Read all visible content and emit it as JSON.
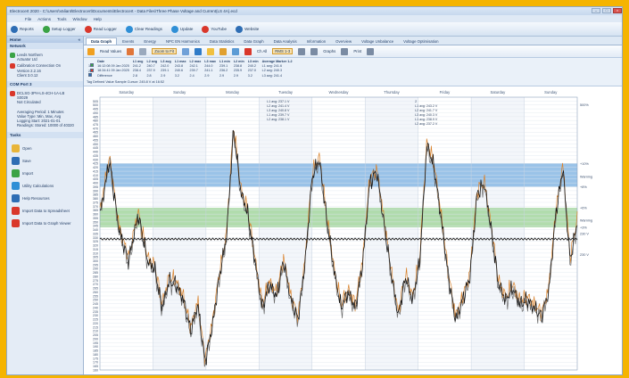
{
  "window": {
    "title": "Electrocert 2020 - C:\\Users\\Valiant\\Electrocert\\Documents\\Electrocert - Data Files\\Three Phase Voltage and Current(LS 4A).ecd"
  },
  "menu": [
    "File",
    "Actions",
    "Tools",
    "Window",
    "Help"
  ],
  "toolbar": [
    {
      "label": "Reports",
      "icon": "reports-icon",
      "color": "#2e6db4"
    },
    {
      "label": "Setup Logger",
      "icon": "setup-logger-icon",
      "color": "#3aa345"
    },
    {
      "label": "Read Logger",
      "icon": "read-logger-icon",
      "color": "#d9372b"
    },
    {
      "label": "Clear Readings",
      "icon": "clear-readings-icon",
      "color": "#2f8fd6"
    },
    {
      "label": "Update",
      "icon": "update-icon",
      "color": "#2f8fd6"
    },
    {
      "label": "YouTube",
      "icon": "youtube-icon",
      "color": "#d9372b"
    },
    {
      "label": "Website",
      "icon": "website-icon",
      "color": "#2e6db4"
    }
  ],
  "left_panel": {
    "header": "Home",
    "section1": "Network",
    "items": [
      {
        "lines": [
          "Leeds Northern",
          "Actuator Ltd"
        ],
        "icon": "site-icon",
        "color": "#3aa345"
      },
      {
        "lines": [
          "Calibration Connection On",
          "Version 2.2.16",
          "Client 3.0.12"
        ],
        "icon": "connection-icon",
        "color": "#d9372b"
      }
    ],
    "section2": "COM Port 3",
    "device": {
      "lines": [
        "DCLSG-3PH-LS-4CH-1A-LB",
        "S0029",
        "Not Circulated",
        "",
        "Averaging Period: 1 Minutes",
        "Value Type: Min, Max, Avg",
        "Logging Start: 2021-01-01",
        "Readings: Stored: 10000 of 40320"
      ]
    },
    "section3": "Tasks",
    "actions": [
      {
        "label": "Open",
        "icon": "folder-open-icon",
        "color": "#e8b53a"
      },
      {
        "label": "Save",
        "icon": "save-icon",
        "color": "#2e6db4"
      },
      {
        "label": "Import",
        "icon": "import-icon",
        "color": "#3aa345"
      },
      {
        "label": "Utility Calculations",
        "icon": "calculator-icon",
        "color": "#2f8fd6"
      },
      {
        "label": "Help Resources",
        "icon": "help-icon",
        "color": "#2e6db4"
      },
      {
        "label": "Import Data to Spreadsheet",
        "icon": "spreadsheet-icon",
        "color": "#d9372b"
      },
      {
        "label": "Import Data to Graph Viewer",
        "icon": "graph-export-icon",
        "color": "#d9372b"
      }
    ]
  },
  "tabs": [
    "Data Graph",
    "Events",
    "Energy",
    "NPC EN Harmonics",
    "Data Statistics",
    "Data Graph",
    "Data Analysis",
    "Information",
    "Overview",
    "Voltage Unbalance",
    "Voltage Optimisation"
  ],
  "chart_toolbar": {
    "mode": "Read Values",
    "zoom": "Zoom to Fit",
    "channel": "Ch All",
    "phases": "RMS 1-3",
    "graphs": "Graphs",
    "print": "Print"
  },
  "data_panel": {
    "headers": [
      "",
      "Date",
      "L1 avg",
      "L2 avg",
      "L3 avg",
      "L1 max",
      "L2 max",
      "L3 max",
      "L1 min",
      "L2 min",
      "L3 min",
      "Average Marker 1-2"
    ],
    "rows": [
      {
        "marker": "1",
        "color": "#3aa345",
        "cells": [
          "16:12:08 09 Jan 2025",
          "241.2",
          "240.7",
          "242.0",
          "243.8",
          "242.1",
          "244.0",
          "239.1",
          "238.8",
          "240.2",
          "L1 avg: 241.6"
        ]
      },
      {
        "marker": "2",
        "color": "#d9372b",
        "cells": [
          "18:34:41 09 Jan 2025",
          "238.4",
          "237.9",
          "239.1",
          "240.6",
          "239.7",
          "241.1",
          "236.2",
          "235.9",
          "237.0",
          "L2 avg: 240.3"
        ]
      },
      {
        "marker": "",
        "color": "#2e6db4",
        "cells": [
          "Difference",
          "2.8",
          "2.8",
          "2.9",
          "3.2",
          "2.4",
          "2.9",
          "2.9",
          "2.9",
          "3.2",
          "L3 avg: 241.4"
        ]
      }
    ],
    "note": "Tag Defined    Value Sample    Cursor: 245.8 V at 16:52"
  },
  "chart_data": {
    "type": "line",
    "days": [
      "Saturday",
      "Sunday",
      "Monday",
      "Tuesday",
      "Wednesday",
      "Thursday",
      "Friday",
      "Saturday",
      "Sunday"
    ],
    "y_ticks": [
      505,
      500,
      495,
      490,
      485,
      480,
      475,
      470,
      465,
      460,
      455,
      450,
      445,
      440,
      435,
      430,
      425,
      420,
      415,
      410,
      405,
      400,
      395,
      390,
      385,
      380,
      375,
      370,
      365,
      360,
      355,
      350,
      345,
      340,
      335,
      330,
      325,
      320,
      315,
      310,
      305,
      300,
      295,
      290,
      285,
      280,
      275,
      270,
      265,
      260,
      255,
      250,
      245,
      240,
      235,
      230,
      225,
      220,
      215,
      210,
      205,
      200,
      195,
      190,
      185,
      180,
      175,
      170,
      165,
      160
    ],
    "ylim": [
      160,
      510
    ],
    "bands": [
      {
        "from": 395,
        "to": 425,
        "color": "#8fbde6",
        "label": "+10%"
      },
      {
        "from": 343,
        "to": 368,
        "color": "#a8d8a4",
        "label": "+6%"
      }
    ],
    "right_labels": [
      {
        "value": 500,
        "text": "500%"
      },
      {
        "value": 425,
        "text": "+10%"
      },
      {
        "value": 408,
        "text": "Warning"
      },
      {
        "value": 395,
        "text": "+8%"
      },
      {
        "value": 368,
        "text": "+6%"
      },
      {
        "value": 352,
        "text": "Warning"
      },
      {
        "value": 343,
        "text": "+3%"
      },
      {
        "value": 335,
        "text": "230 V"
      },
      {
        "value": 308,
        "text": "230 V"
      }
    ],
    "annotations": [
      {
        "x": 0.35,
        "lines": [
          "L1 avg: 237.1 V",
          "L2 avg: 241.4 V",
          "L3 avg: 240.8 V",
          "L1 avg: 239.7 V",
          "L2 avg: 238.1 V"
        ]
      },
      {
        "x": 0.66,
        "lines": [
          "2",
          "L1 avg: 243.2 V",
          "L2 avg: 241.7 V",
          "L3 avg: 240.3 V",
          "L1 avg: 238.9 V",
          "L2 avg: 237.2 V"
        ]
      }
    ],
    "series": [
      {
        "name": "L1",
        "color": "#d9822b",
        "offset": 4
      },
      {
        "name": "L2",
        "color": "#6b6b6b",
        "offset": -4
      },
      {
        "name": "L3",
        "color": "#111111",
        "offset": 0
      },
      {
        "name": "Neutral",
        "color": "#222222",
        "flat": 328
      }
    ],
    "profile": [
      [
        0,
        360
      ],
      [
        0.02,
        430
      ],
      [
        0.04,
        340
      ],
      [
        0.06,
        300
      ],
      [
        0.08,
        360
      ],
      [
        0.1,
        300
      ],
      [
        0.115,
        290
      ],
      [
        0.13,
        240
      ],
      [
        0.145,
        275
      ],
      [
        0.16,
        270
      ],
      [
        0.175,
        250
      ],
      [
        0.19,
        210
      ],
      [
        0.205,
        245
      ],
      [
        0.22,
        170
      ],
      [
        0.235,
        215
      ],
      [
        0.25,
        280
      ],
      [
        0.265,
        330
      ],
      [
        0.28,
        470
      ],
      [
        0.295,
        390
      ],
      [
        0.31,
        360
      ],
      [
        0.325,
        300
      ],
      [
        0.34,
        240
      ],
      [
        0.355,
        270
      ],
      [
        0.37,
        255
      ],
      [
        0.385,
        300
      ],
      [
        0.4,
        250
      ],
      [
        0.415,
        225
      ],
      [
        0.43,
        300
      ],
      [
        0.445,
        410
      ],
      [
        0.46,
        430
      ],
      [
        0.475,
        355
      ],
      [
        0.49,
        290
      ],
      [
        0.505,
        240
      ],
      [
        0.52,
        260
      ],
      [
        0.535,
        240
      ],
      [
        0.55,
        295
      ],
      [
        0.565,
        400
      ],
      [
        0.58,
        415
      ],
      [
        0.595,
        350
      ],
      [
        0.61,
        285
      ],
      [
        0.625,
        230
      ],
      [
        0.64,
        280
      ],
      [
        0.655,
        250
      ],
      [
        0.67,
        300
      ],
      [
        0.685,
        450
      ],
      [
        0.7,
        420
      ],
      [
        0.715,
        355
      ],
      [
        0.73,
        280
      ],
      [
        0.745,
        225
      ],
      [
        0.76,
        250
      ],
      [
        0.775,
        280
      ],
      [
        0.79,
        385
      ],
      [
        0.805,
        400
      ],
      [
        0.82,
        340
      ],
      [
        0.835,
        270
      ],
      [
        0.85,
        250
      ],
      [
        0.865,
        265
      ],
      [
        0.88,
        245
      ],
      [
        0.895,
        250
      ],
      [
        0.91,
        240
      ],
      [
        0.925,
        230
      ],
      [
        0.94,
        260
      ],
      [
        0.955,
        360
      ],
      [
        0.97,
        420
      ],
      [
        0.985,
        300
      ],
      [
        1.0,
        350
      ]
    ]
  }
}
